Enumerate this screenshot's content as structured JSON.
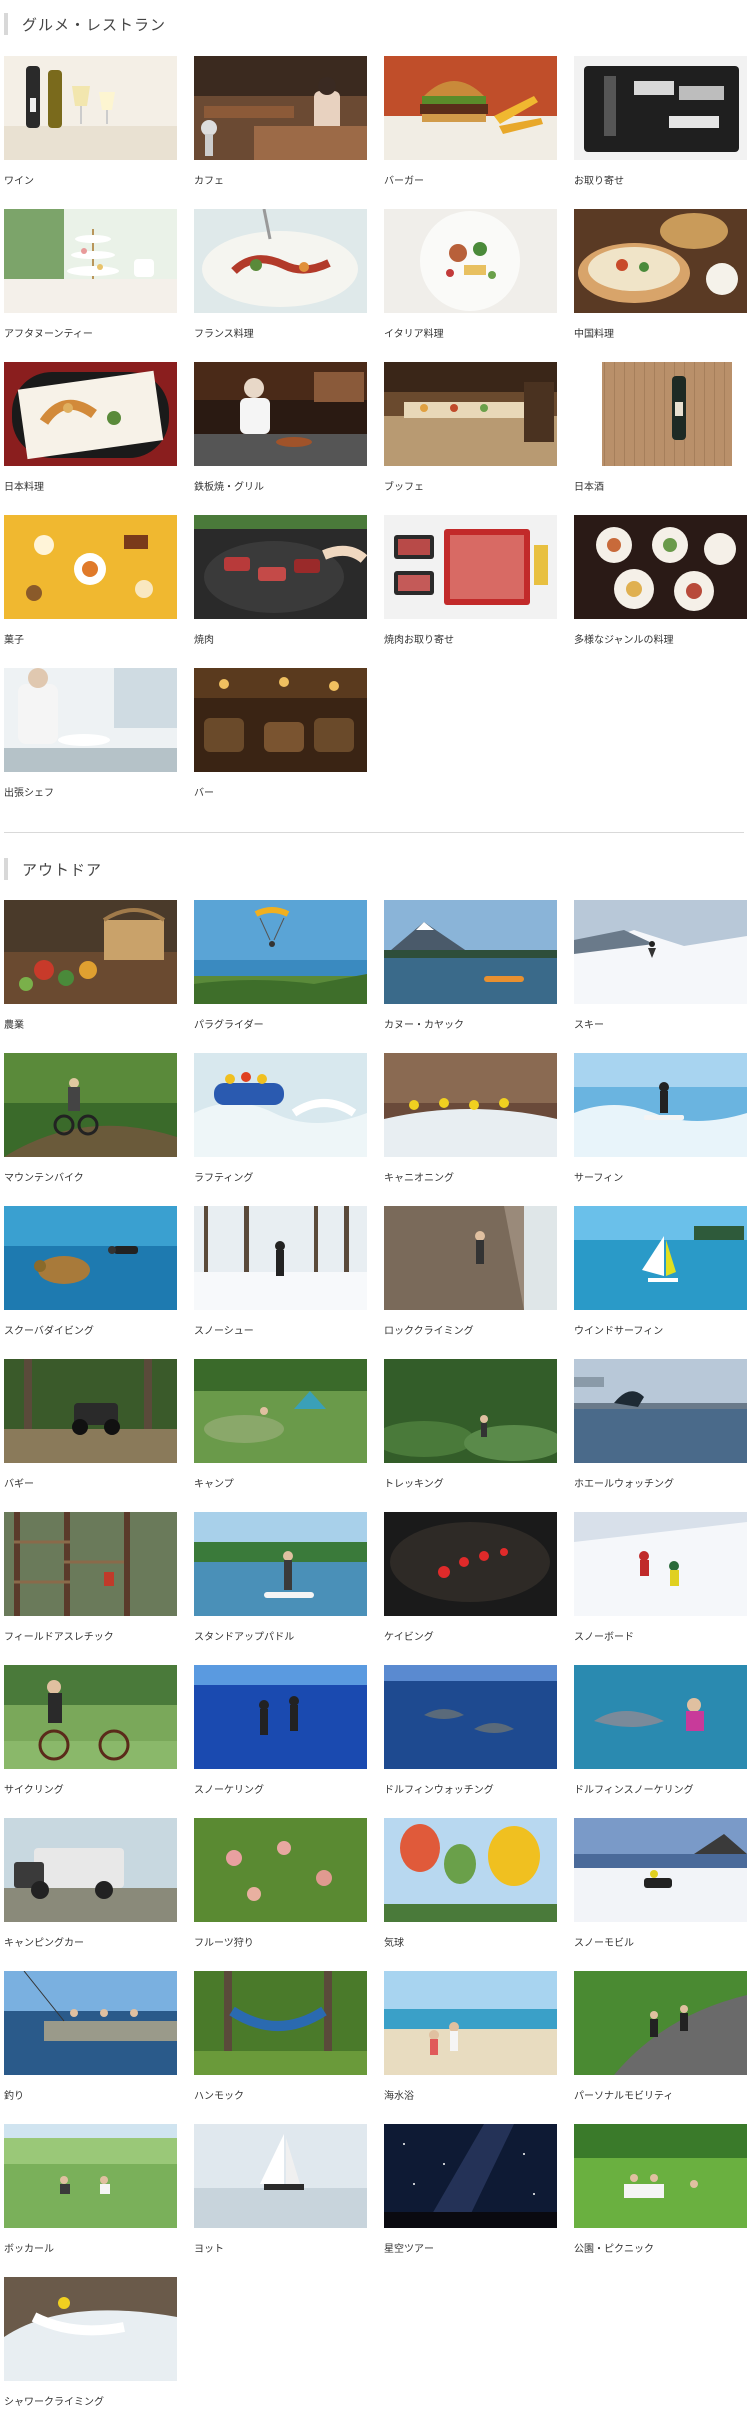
{
  "sections": [
    {
      "title": "グルメ・レストラン",
      "items": [
        {
          "label": "ワイン",
          "scene": "wine"
        },
        {
          "label": "カフェ",
          "scene": "cafe"
        },
        {
          "label": "バーガー",
          "scene": "burger"
        },
        {
          "label": "お取り寄せ",
          "scene": "giftbox"
        },
        {
          "label": "アフタヌーンティー",
          "scene": "afternoon"
        },
        {
          "label": "フランス料理",
          "scene": "french"
        },
        {
          "label": "イタリア料理",
          "scene": "italian"
        },
        {
          "label": "中国料理",
          "scene": "chinese"
        },
        {
          "label": "日本料理",
          "scene": "japanese"
        },
        {
          "label": "鉄板焼・グリル",
          "scene": "teppan"
        },
        {
          "label": "ブッフェ",
          "scene": "buffet"
        },
        {
          "label": "日本酒",
          "scene": "sake"
        },
        {
          "label": "菓子",
          "scene": "sweets"
        },
        {
          "label": "焼肉",
          "scene": "yakiniku"
        },
        {
          "label": "焼肉お取り寄せ",
          "scene": "meatbox"
        },
        {
          "label": "多様なジャンルの料理",
          "scene": "variety"
        },
        {
          "label": "出張シェフ",
          "scene": "chef"
        },
        {
          "label": "バー",
          "scene": "bar"
        }
      ]
    },
    {
      "title": "アウトドア",
      "items": [
        {
          "label": "農業",
          "scene": "farm"
        },
        {
          "label": "パラグライダー",
          "scene": "paraglider"
        },
        {
          "label": "カヌー・カヤック",
          "scene": "canoe"
        },
        {
          "label": "スキー",
          "scene": "ski"
        },
        {
          "label": "マウンテンバイク",
          "scene": "mtb"
        },
        {
          "label": "ラフティング",
          "scene": "rafting"
        },
        {
          "label": "キャニオニング",
          "scene": "canyoning"
        },
        {
          "label": "サーフィン",
          "scene": "surfing"
        },
        {
          "label": "スクーバダイビング",
          "scene": "diving"
        },
        {
          "label": "スノーシュー",
          "scene": "snowshoe"
        },
        {
          "label": "ロッククライミング",
          "scene": "rock"
        },
        {
          "label": "ウインドサーフィン",
          "scene": "windsurf"
        },
        {
          "label": "バギー",
          "scene": "buggy"
        },
        {
          "label": "キャンプ",
          "scene": "camp"
        },
        {
          "label": "トレッキング",
          "scene": "trekking"
        },
        {
          "label": "ホエールウォッチング",
          "scene": "whale"
        },
        {
          "label": "フィールドアスレチック",
          "scene": "athletic"
        },
        {
          "label": "スタンドアップパドル",
          "scene": "sup"
        },
        {
          "label": "ケイビング",
          "scene": "caving"
        },
        {
          "label": "スノーボード",
          "scene": "snowboard"
        },
        {
          "label": "サイクリング",
          "scene": "cycling"
        },
        {
          "label": "スノーケリング",
          "scene": "snorkel"
        },
        {
          "label": "ドルフィンウォッチング",
          "scene": "dolphin"
        },
        {
          "label": "ドルフィンスノーケリング",
          "scene": "dolphinswim"
        },
        {
          "label": "キャンピングカー",
          "scene": "camper"
        },
        {
          "label": "フルーツ狩り",
          "scene": "fruit"
        },
        {
          "label": "気球",
          "scene": "balloon"
        },
        {
          "label": "スノーモビル",
          "scene": "snowmobile"
        },
        {
          "label": "釣り",
          "scene": "fishing"
        },
        {
          "label": "ハンモック",
          "scene": "hammock"
        },
        {
          "label": "海水浴",
          "scene": "beach"
        },
        {
          "label": "パーソナルモビリティ",
          "scene": "mobility"
        },
        {
          "label": "ボッカール",
          "scene": "bocce"
        },
        {
          "label": "ヨット",
          "scene": "yacht"
        },
        {
          "label": "星空ツアー",
          "scene": "stars"
        },
        {
          "label": "公園・ピクニック",
          "scene": "picnic"
        },
        {
          "label": "シャワークライミング",
          "scene": "shower"
        }
      ]
    }
  ]
}
